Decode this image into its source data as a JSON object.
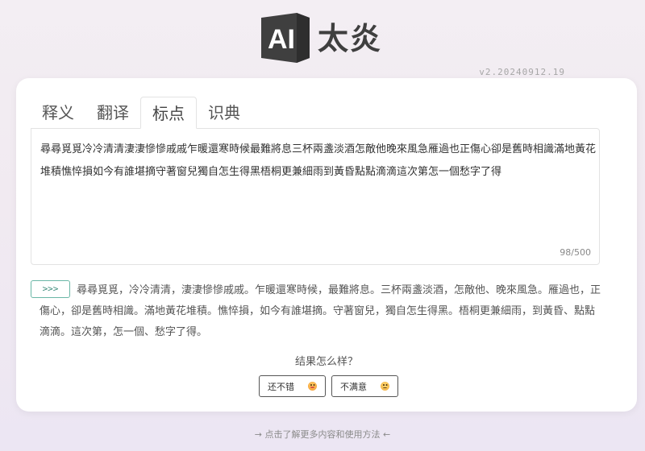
{
  "logo": {
    "mark_text": "AI",
    "name": "太炎"
  },
  "version": "v2.20240912.19",
  "tabs": [
    {
      "label": "释义",
      "active": false
    },
    {
      "label": "翻译",
      "active": false
    },
    {
      "label": "标点",
      "active": true
    },
    {
      "label": "识典",
      "active": false
    }
  ],
  "input": {
    "text": "尋尋覓覓冷冷清清淒淒慘慘戚戚乍暖還寒時候最難將息三杯兩盞淡酒怎敵他晚來風急雁過也正傷心卻是舊時相識滿地黃花堆積憔悴損如今有誰堪摘守著窗兒獨自怎生得黑梧桐更兼細雨到黃昏點點滴滴這次第怎一個愁字了得",
    "char_count": "98/500"
  },
  "run_button_label": ">>>",
  "result_text": "尋尋覓覓，冷冷清清，淒淒慘慘戚戚。乍暖還寒時候，最難將息。三杯兩盞淡酒，怎敵他、晚來風急。雁過也，正傷心，卻是舊時相識。滿地黃花堆積。憔悴損，如今有誰堪摘。守著窗兒，獨自怎生得黑。梧桐更兼細雨，到黃昏、點點滴滴。這次第，怎一個、愁字了得。",
  "feedback": {
    "question": "结果怎么样？",
    "good_label": "还不错",
    "bad_label": "不满意"
  },
  "footer_link": "→ 点击了解更多内容和使用方法 ←",
  "colors": {
    "accent": "#3c8c7b",
    "logo": "#3f3f3f"
  },
  "icons": {
    "good": "grinning-face-emoji-icon",
    "bad": "pensive-face-emoji-icon"
  }
}
